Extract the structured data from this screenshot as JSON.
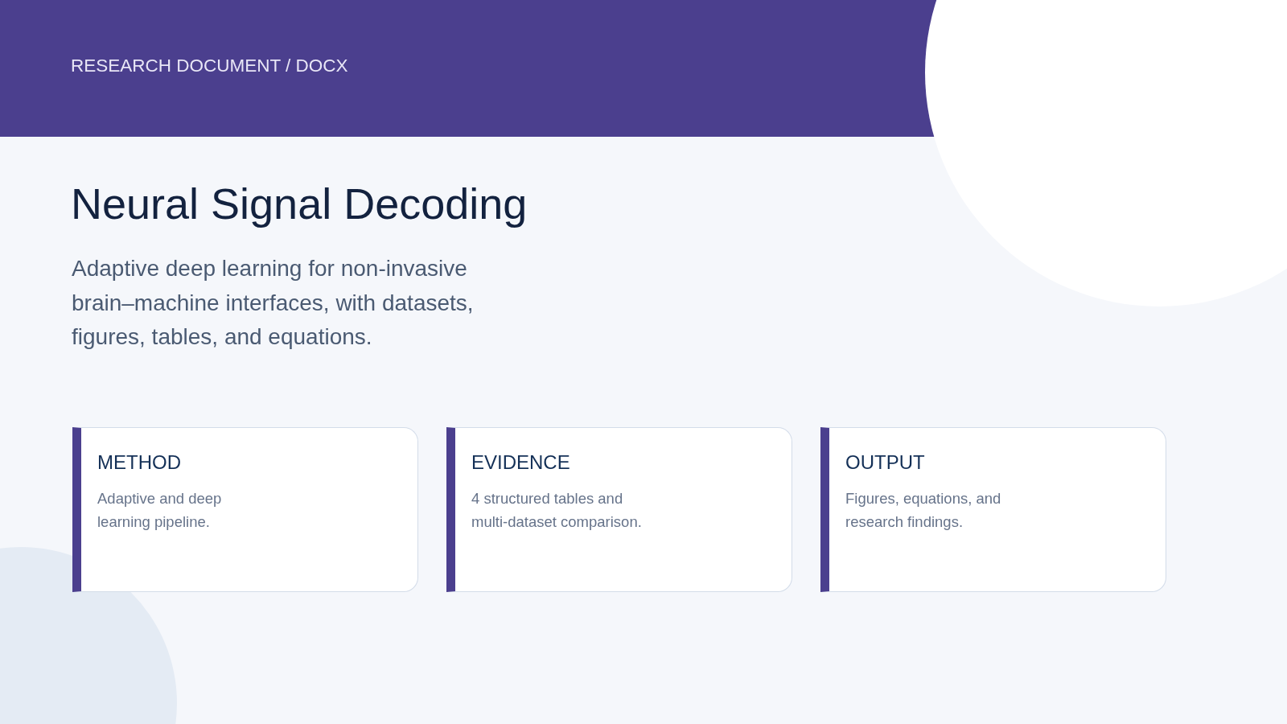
{
  "header": {
    "label": "RESEARCH DOCUMENT / DOCX"
  },
  "title": "Neural Signal Decoding",
  "subtitle": "Adaptive deep learning for non-invasive brain–machine interfaces, with datasets, figures, tables, and equations.",
  "cards": [
    {
      "heading": "METHOD",
      "text": "Adaptive and deep learning pipeline."
    },
    {
      "heading": "EVIDENCE",
      "text": "4 structured tables and multi-dataset comparison."
    },
    {
      "heading": "OUTPUT",
      "text": "Figures, equations, and research findings."
    }
  ]
}
